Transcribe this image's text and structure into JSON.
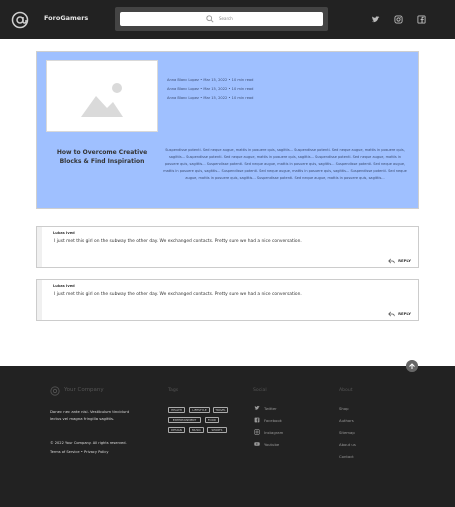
{
  "header": {
    "brand": "ForoGamers",
    "search_placeholder": "Search",
    "social_icons": [
      "twitter-icon",
      "instagram-icon",
      "facebook-icon"
    ]
  },
  "post": {
    "title": "How to Overcome Creative Blocks & Find Inspiration",
    "meta": [
      "Anna Blanc Lopez  •  Mar 15, 2022  •  10 min read",
      "Anna Blanc Lopez  •  Mar 15, 2022  •  10 min read",
      "Anna Blanc Lopez  •  Mar 15, 2022  •  10 min read"
    ],
    "excerpt": "Suspendisse potenti. Sed neque augue, mattis in posuere quis, sagittis... Suspendisse potenti. Sed neque augue, mattis in posuere quis, sagittis... Suspendisse potenti. Sed neque augue, mattis in posuere quis, sagittis... Suspendisse potenti. Sed neque augue, mattis in posuere quis, sagittis... Suspendisse potenti. Sed neque augue, mattis in posuere quis, sagittis... Suspendisse potenti. Sed neque augue, mattis in posuere quis, sagittis... Suspendisse potenti. Sed neque augue, mattis in posuere quis, sagittis... Suspendisse potenti. Sed neque augue, mattis in posuere quis, sagittis... Suspendisse potenti. Sed neque augue, mattis in posuere quis, sagittis..."
  },
  "comments": [
    {
      "author": "Lukas Ived",
      "text": "I just met this girl on the subway the other day. We exchanged contacts. Pretty sure we had a nice conversation.",
      "reply": "REPLY"
    },
    {
      "author": "Lukas Ived",
      "text": "I just met this girl on the subway the other day. We exchanged contacts. Pretty sure we had a nice conversation.",
      "reply": "REPLY"
    }
  ],
  "footer": {
    "brand": "Your Company",
    "description": "Donec nec ante nisi. Vestibulum tincidunt lectus vel magna fringilla sagittis.",
    "copyright": "© 2022 Your Company. All rights reserved.",
    "legal": "Terms of Service  •  Privacy Policy",
    "tags_title": "Tags",
    "tags": [
      "HEALTH",
      "LIFESTYLE",
      "TRAVEL",
      "ENTERTAINMENT",
      "FOOD",
      "DESIGN",
      "MUSIC",
      "SPORTS"
    ],
    "social_title": "Social",
    "social": [
      {
        "label": "Twitter",
        "icon": "twitter-icon"
      },
      {
        "label": "Facebook",
        "icon": "facebook-icon"
      },
      {
        "label": "Instagram",
        "icon": "instagram-icon"
      },
      {
        "label": "Youtube",
        "icon": "youtube-icon"
      }
    ],
    "about_title": "About",
    "about": [
      "Shop",
      "Authors",
      "Sitemap",
      "About us",
      "Contact"
    ]
  },
  "colors": {
    "header_bg": "#222222",
    "card_bg": "#9fc0ff",
    "footer_bg": "#222222"
  }
}
